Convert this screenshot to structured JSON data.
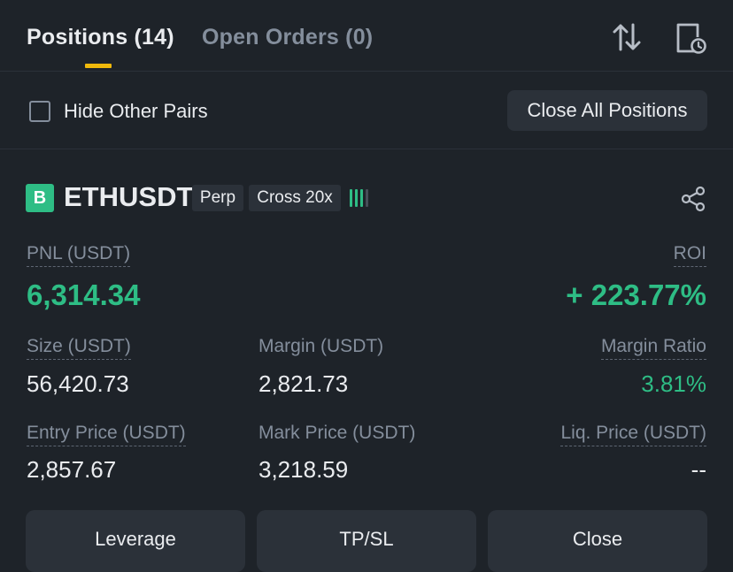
{
  "tabs": {
    "positions": "Positions (14)",
    "open_orders": "Open Orders (0)"
  },
  "icons": {
    "sort": "sort-arrows-icon",
    "history": "history-document-icon",
    "share": "share-icon"
  },
  "filter": {
    "hide_other_pairs": "Hide Other Pairs",
    "close_all": "Close All Positions"
  },
  "position": {
    "side_badge": "B",
    "symbol": "ETHUSDT",
    "type_tag": "Perp",
    "margin_tag": "Cross 20x",
    "pnl_label": "PNL (USDT)",
    "pnl_value": "6,314.34",
    "roi_label": "ROI",
    "roi_value": "+ 223.77%",
    "size_label": "Size (USDT)",
    "size_value": "56,420.73",
    "margin_label": "Margin (USDT)",
    "margin_value": "2,821.73",
    "margin_ratio_label": "Margin Ratio",
    "margin_ratio_value": "3.81%",
    "entry_label": "Entry Price (USDT)",
    "entry_value": "2,857.67",
    "mark_label": "Mark Price (USDT)",
    "mark_value": "3,218.59",
    "liq_label": "Liq. Price (USDT)",
    "liq_value": "--"
  },
  "actions": {
    "leverage": "Leverage",
    "tpsl": "TP/SL",
    "close": "Close"
  },
  "colors": {
    "background": "#1e2329",
    "accent": "#f0b90b",
    "positive": "#2ebd85",
    "muted": "#848e9c"
  }
}
